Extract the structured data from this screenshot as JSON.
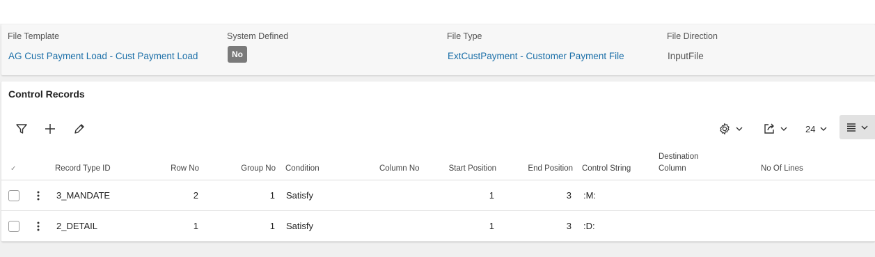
{
  "header": {
    "file_template": {
      "label": "File Template",
      "value": "AG Cust Payment Load - Cust Payment Load"
    },
    "system_defined": {
      "label": "System Defined",
      "value": "No"
    },
    "file_type": {
      "label": "File Type",
      "value": "ExtCustPayment - Customer Payment File"
    },
    "file_direction": {
      "label": "File Direction",
      "value": "InputFile"
    }
  },
  "records": {
    "title": "Control Records",
    "toolbar": {
      "filter_icon": "filter-icon",
      "add_icon": "plus-icon",
      "edit_icon": "pencil-icon",
      "settings_icon": "gear-icon",
      "export_icon": "export-icon",
      "page_size": "24",
      "view_icon": "list-view-icon"
    },
    "columns": {
      "select_all": "✓",
      "record_type_id": "Record Type ID",
      "row_no": "Row No",
      "group_no": "Group No",
      "condition": "Condition",
      "column_no": "Column No",
      "start_position": "Start Position",
      "end_position": "End Position",
      "control_string": "Control String",
      "destination_column_line1": "Destination",
      "destination_column_line2": "Column",
      "no_of_lines": "No Of Lines"
    },
    "rows": [
      {
        "record_type_id": "3_MANDATE",
        "row_no": "2",
        "group_no": "1",
        "condition": "Satisfy",
        "column_no": "",
        "start_position": "1",
        "end_position": "3",
        "control_string": ":M:",
        "destination_column": "",
        "no_of_lines": ""
      },
      {
        "record_type_id": "2_DETAIL",
        "row_no": "1",
        "group_no": "1",
        "condition": "Satisfy",
        "column_no": "",
        "start_position": "1",
        "end_position": "3",
        "control_string": ":D:",
        "destination_column": "",
        "no_of_lines": ""
      }
    ]
  },
  "colors": {
    "link": "#1b6fa8",
    "badge_bg": "#7a7a7a",
    "page_bg": "#f0f0f0"
  }
}
